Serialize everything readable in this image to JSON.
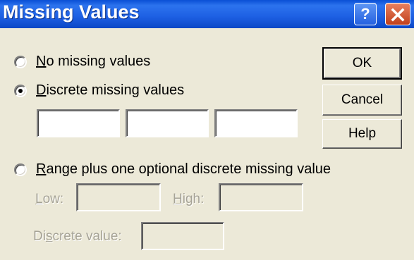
{
  "window": {
    "title": "Missing Values",
    "help_glyph": "?",
    "close_icon": "close-icon"
  },
  "options": {
    "no_missing": {
      "mnemonic": "N",
      "rest": "o missing values",
      "selected": false
    },
    "discrete": {
      "mnemonic": "D",
      "rest": "iscrete missing values",
      "selected": true,
      "values": [
        "",
        "",
        ""
      ]
    },
    "range": {
      "mnemonic": "R",
      "rest": "ange plus one optional discrete missing value",
      "selected": false,
      "low_mnemonic": "L",
      "low_rest": "ow:",
      "low_value": "",
      "high_mnemonic": "H",
      "high_rest": "igh:",
      "high_value": "",
      "discrete_pre": "Di",
      "discrete_mnemonic": "s",
      "discrete_rest": "crete value:",
      "discrete_value": "",
      "enabled": false
    }
  },
  "buttons": {
    "ok": "OK",
    "cancel": "Cancel",
    "help": "Help"
  },
  "colors": {
    "dialog_bg": "#ece9d8",
    "titlebar": "#0a4fd6",
    "disabled_text": "#a6a396"
  }
}
